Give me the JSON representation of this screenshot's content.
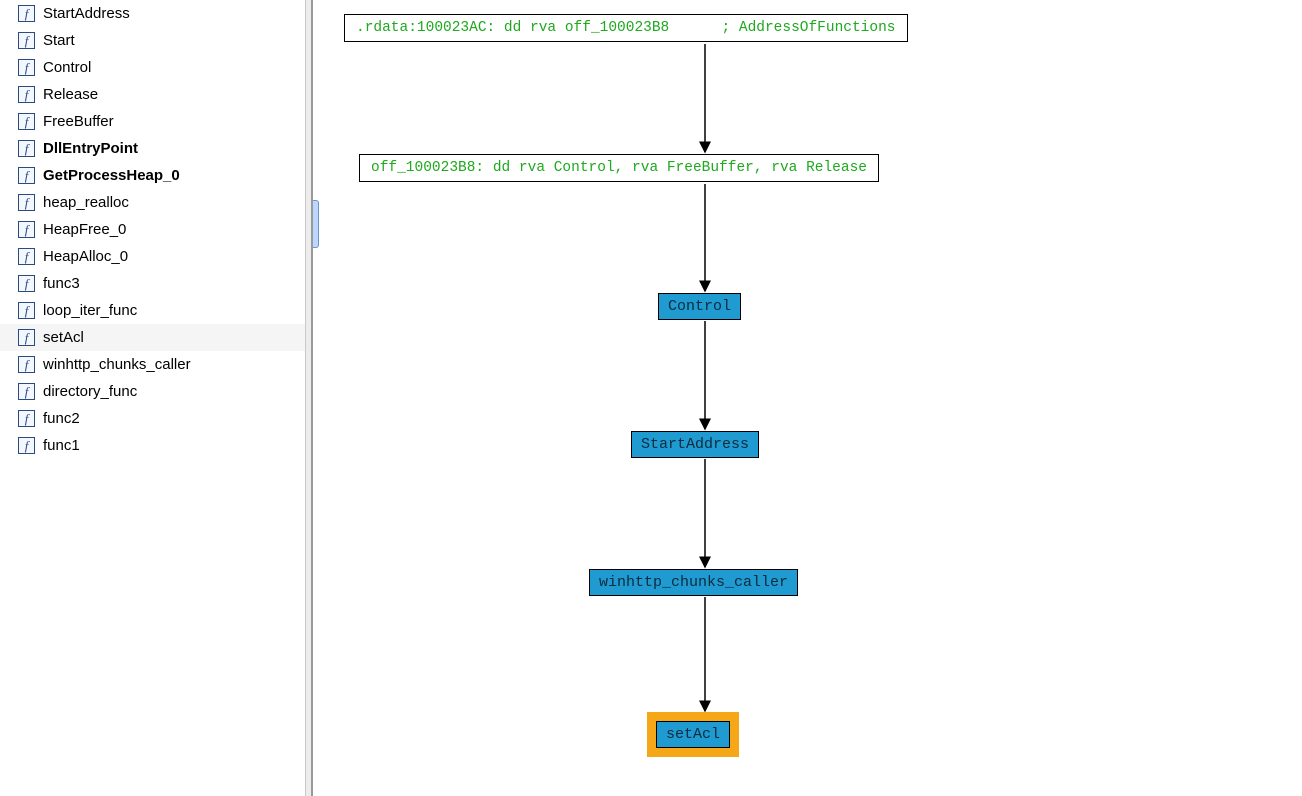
{
  "functions": [
    {
      "name": "StartAddress",
      "bold": false,
      "selected": false
    },
    {
      "name": "Start",
      "bold": false,
      "selected": false
    },
    {
      "name": "Control",
      "bold": false,
      "selected": false
    },
    {
      "name": "Release",
      "bold": false,
      "selected": false
    },
    {
      "name": "FreeBuffer",
      "bold": false,
      "selected": false
    },
    {
      "name": "DllEntryPoint",
      "bold": true,
      "selected": false
    },
    {
      "name": "GetProcessHeap_0",
      "bold": true,
      "selected": false
    },
    {
      "name": "heap_realloc",
      "bold": false,
      "selected": false
    },
    {
      "name": "HeapFree_0",
      "bold": false,
      "selected": false
    },
    {
      "name": "HeapAlloc_0",
      "bold": false,
      "selected": false
    },
    {
      "name": "func3",
      "bold": false,
      "selected": false
    },
    {
      "name": "loop_iter_func",
      "bold": false,
      "selected": false
    },
    {
      "name": "setAcl",
      "bold": false,
      "selected": true
    },
    {
      "name": "winhttp_chunks_caller",
      "bold": false,
      "selected": false
    },
    {
      "name": "directory_func",
      "bold": false,
      "selected": false
    },
    {
      "name": "func2",
      "bold": false,
      "selected": false
    },
    {
      "name": "func1",
      "bold": false,
      "selected": false
    }
  ],
  "graph": {
    "nodes": {
      "rdata": ".rdata:100023AC: dd rva off_100023B8      ; AddressOfFunctions",
      "off": "off_100023B8: dd rva Control, rva FreeBuffer, rva Release",
      "control": "Control",
      "startaddr": "StartAddress",
      "whcc": "winhttp_chunks_caller",
      "setacl": "setAcl"
    }
  },
  "icon_glyph": "f"
}
